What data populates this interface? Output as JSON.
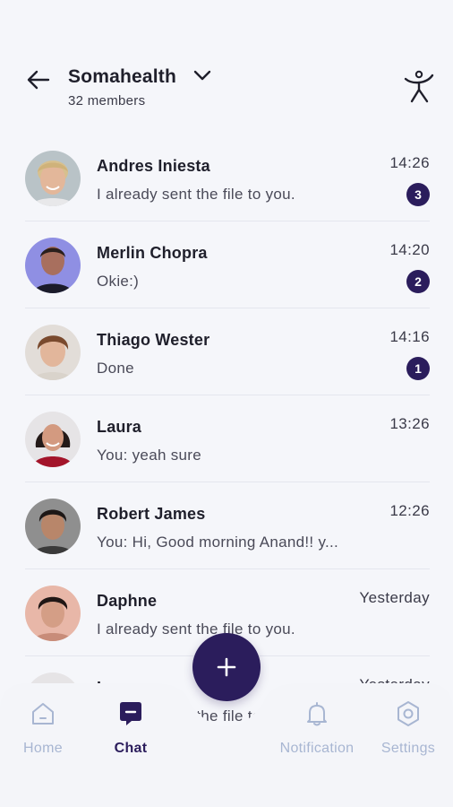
{
  "header": {
    "title": "Somahealth",
    "members": "32 members"
  },
  "chats": [
    {
      "name": "Andres Iniesta",
      "message": "I already sent the file to you.",
      "time": "14:26",
      "unread": "3"
    },
    {
      "name": "Merlin Chopra",
      "message": "Okie:)",
      "time": "14:20",
      "unread": "2"
    },
    {
      "name": "Thiago Wester",
      "message": "Done",
      "time": "14:16",
      "unread": "1"
    },
    {
      "name": "Laura",
      "message": "You: yeah sure",
      "time": "13:26",
      "unread": ""
    },
    {
      "name": "Robert James",
      "message": "You: Hi, Good morning Anand!! y...",
      "time": "12:26",
      "unread": ""
    },
    {
      "name": "Daphne",
      "message": "I already sent the file to you.",
      "time": "Yesterday",
      "unread": ""
    },
    {
      "name": "Laura",
      "message": "I already sent the file to you.",
      "time": "Yesterday",
      "unread": ""
    }
  ],
  "nav": {
    "home": "Home",
    "chat": "Chat",
    "notification": "Notification",
    "settings": "Settings"
  },
  "colors": {
    "accent": "#2b1d5c",
    "background": "#f5f6fa",
    "nav_inactive": "#a8b6d2"
  }
}
